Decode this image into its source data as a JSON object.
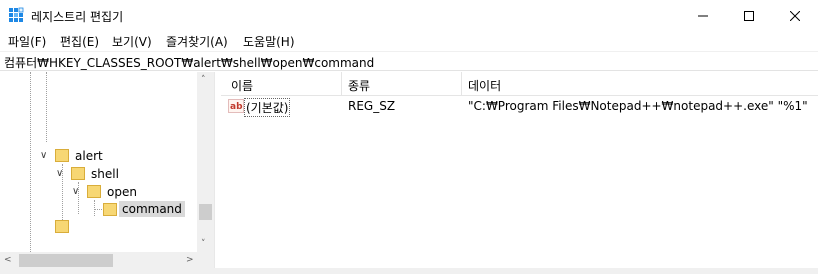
{
  "window": {
    "title": "레지스트리 편집기"
  },
  "menu": {
    "items": [
      {
        "label": "파일(F)"
      },
      {
        "label": "편집(E)"
      },
      {
        "label": "보기(V)"
      },
      {
        "label": "즐겨찾기(A)"
      },
      {
        "label": "도움말(H)"
      }
    ]
  },
  "address": {
    "path": "컴퓨터₩HKEY_CLASSES_ROOT₩alert₩shell₩open₩command"
  },
  "tree": {
    "nodes": [
      {
        "label": "alert",
        "expanded": true
      },
      {
        "label": "shell",
        "expanded": true
      },
      {
        "label": "open",
        "expanded": true
      },
      {
        "label": "command",
        "selected": true
      }
    ]
  },
  "list": {
    "columns": [
      "이름",
      "종류",
      "데이터"
    ],
    "rows": [
      {
        "name": "(기본값)",
        "type": "REG_SZ",
        "data": "\"C:₩Program Files₩Notepad++₩notepad++.exe\" \"%1\"",
        "icon": "reg-string-ab-icon"
      }
    ]
  },
  "colors": {
    "selection": "#d9d9d9",
    "folder": "#f7d774",
    "folder_edge": "#d9ad3a",
    "ab_icon": "#c0392b"
  }
}
